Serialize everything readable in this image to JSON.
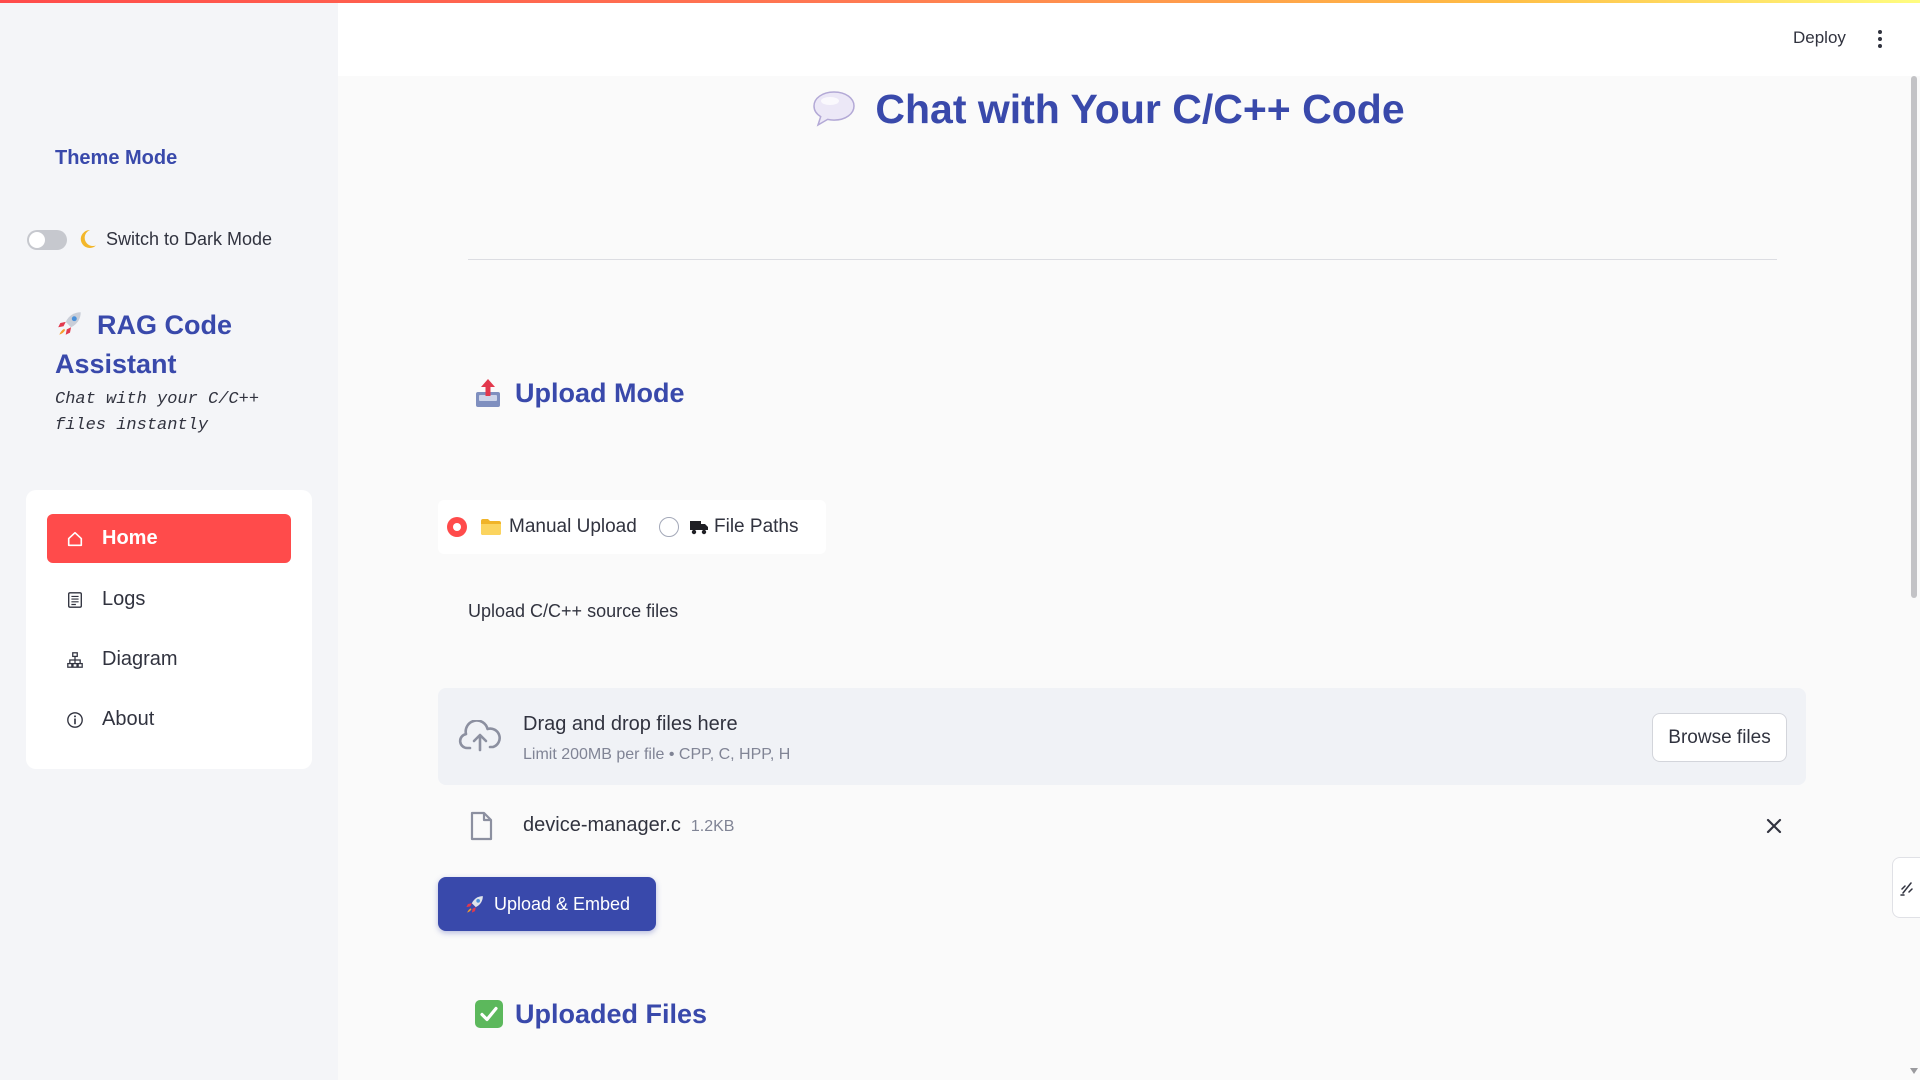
{
  "colors": {
    "accent": "#3949ab",
    "primary": "#ff4b4b",
    "text": "#31333f",
    "muted": "#808495",
    "dropzone_bg": "#f0f2f6"
  },
  "header": {
    "deploy_label": "Deploy",
    "menu_icon": "kebab-menu-icon"
  },
  "sidebar": {
    "theme_heading": "Theme Mode",
    "dark_mode_toggle": {
      "icon": "moon-icon",
      "label": "Switch to Dark Mode",
      "checked": false
    },
    "brand": {
      "icon": "rocket-icon",
      "title": "RAG Code Assistant",
      "tagline": "Chat with your C/C++ files instantly"
    },
    "nav": [
      {
        "label": "Home",
        "icon": "home-icon",
        "active": true
      },
      {
        "label": "Logs",
        "icon": "logs-icon",
        "active": false
      },
      {
        "label": "Diagram",
        "icon": "diagram-icon",
        "active": false
      },
      {
        "label": "About",
        "icon": "info-icon",
        "active": false
      }
    ]
  },
  "main": {
    "title": {
      "icon": "speech-bubble-icon",
      "text": "Chat with Your C/C++ Code"
    },
    "upload_mode": {
      "icon": "outbox-tray-icon",
      "heading": "Upload Mode",
      "options": [
        {
          "icon": "folder-icon",
          "label": "Manual Upload",
          "selected": true
        },
        {
          "icon": "truck-icon",
          "label": "File Paths",
          "selected": false
        }
      ]
    },
    "uploader": {
      "label": "Upload C/C++ source files",
      "icon": "cloud-upload-icon",
      "drop_text": "Drag and drop files here",
      "limit_text": "Limit 200MB per file • CPP, C, HPP, H",
      "browse_label": "Browse files"
    },
    "files": [
      {
        "icon": "file-icon",
        "name": "device-manager.c",
        "size": "1.2KB"
      }
    ],
    "upload_button": {
      "icon": "rocket-icon",
      "label": "Upload & Embed"
    },
    "uploaded_files": {
      "icon": "check-mark-button-icon",
      "heading": "Uploaded Files"
    }
  }
}
